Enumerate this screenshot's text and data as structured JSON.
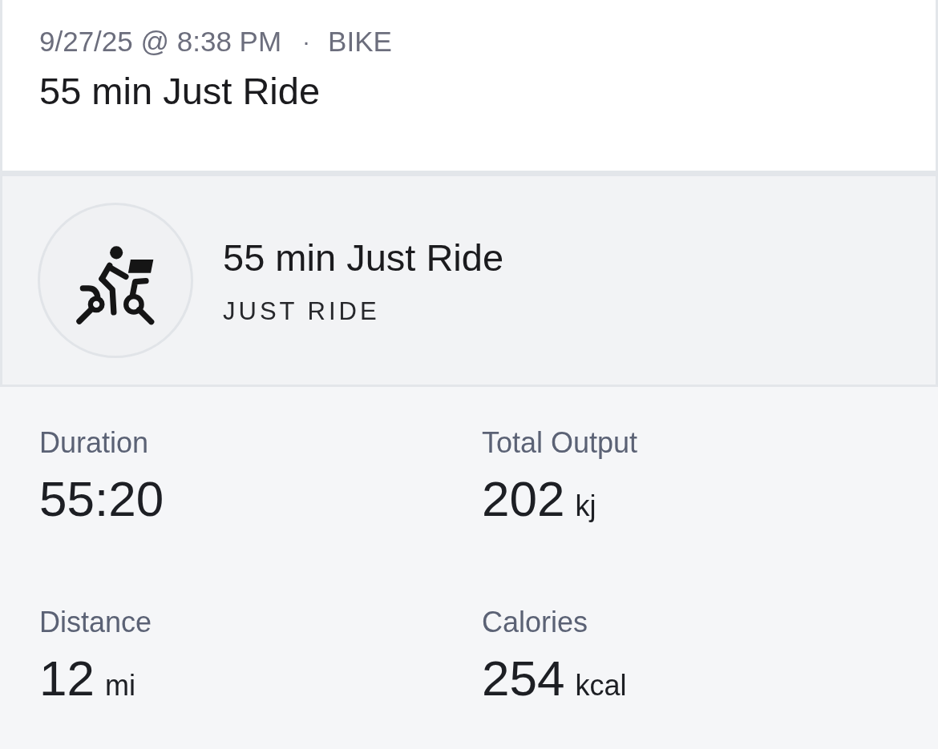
{
  "header": {
    "date": "9/27/25 @ 8:38 PM",
    "separator": "·",
    "discipline": "BIKE",
    "title": "55 min Just Ride"
  },
  "class_card": {
    "title": "55 min Just Ride",
    "subtitle": "JUST RIDE"
  },
  "stats": [
    {
      "label": "Duration",
      "value": "55:20"
    },
    {
      "label": "Total Output",
      "value": "202",
      "unit": "kj"
    },
    {
      "label": "Distance",
      "value": "12",
      "unit": "mi"
    },
    {
      "label": "Calories",
      "value": "254",
      "unit": "kcal"
    }
  ]
}
